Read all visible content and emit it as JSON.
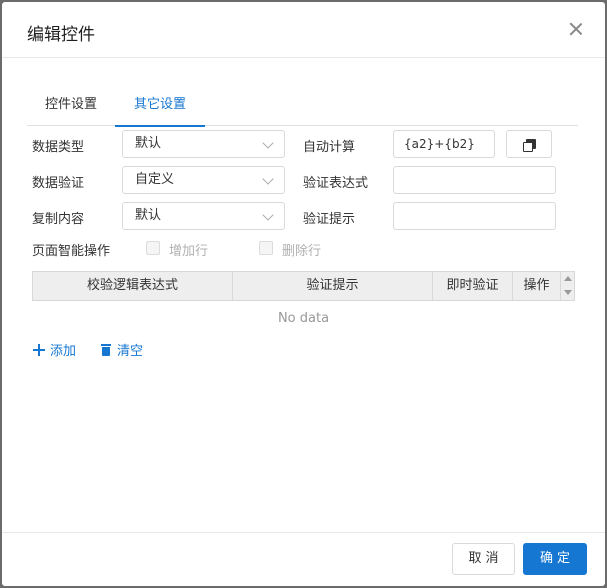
{
  "dialog": {
    "title": "编辑控件"
  },
  "tabs": [
    {
      "label": "控件设置",
      "active": false
    },
    {
      "label": "其它设置",
      "active": true
    }
  ],
  "form": {
    "data_type": {
      "label": "数据类型",
      "value": "默认"
    },
    "auto_calc": {
      "label": "自动计算",
      "value": "{a2}+{b2}"
    },
    "data_validation": {
      "label": "数据验证",
      "value": "自定义"
    },
    "validation_expr": {
      "label": "验证表达式",
      "value": ""
    },
    "copy_content": {
      "label": "复制内容",
      "value": "默认"
    },
    "validation_hint": {
      "label": "验证提示",
      "value": ""
    },
    "page_smart_ops": {
      "label": "页面智能操作"
    },
    "add_row": {
      "label": "增加行",
      "checked": false,
      "disabled": true
    },
    "delete_row": {
      "label": "删除行",
      "checked": false,
      "disabled": true
    }
  },
  "table": {
    "columns": [
      "校验逻辑表达式",
      "验证提示",
      "即时验证",
      "操作"
    ],
    "empty_text": "No data"
  },
  "actions": {
    "add": "添加",
    "clear": "清空"
  },
  "footer": {
    "cancel": "取消",
    "ok": "确定"
  },
  "colors": {
    "accent": "#1677d2",
    "header_bg": "#eeeeee"
  }
}
